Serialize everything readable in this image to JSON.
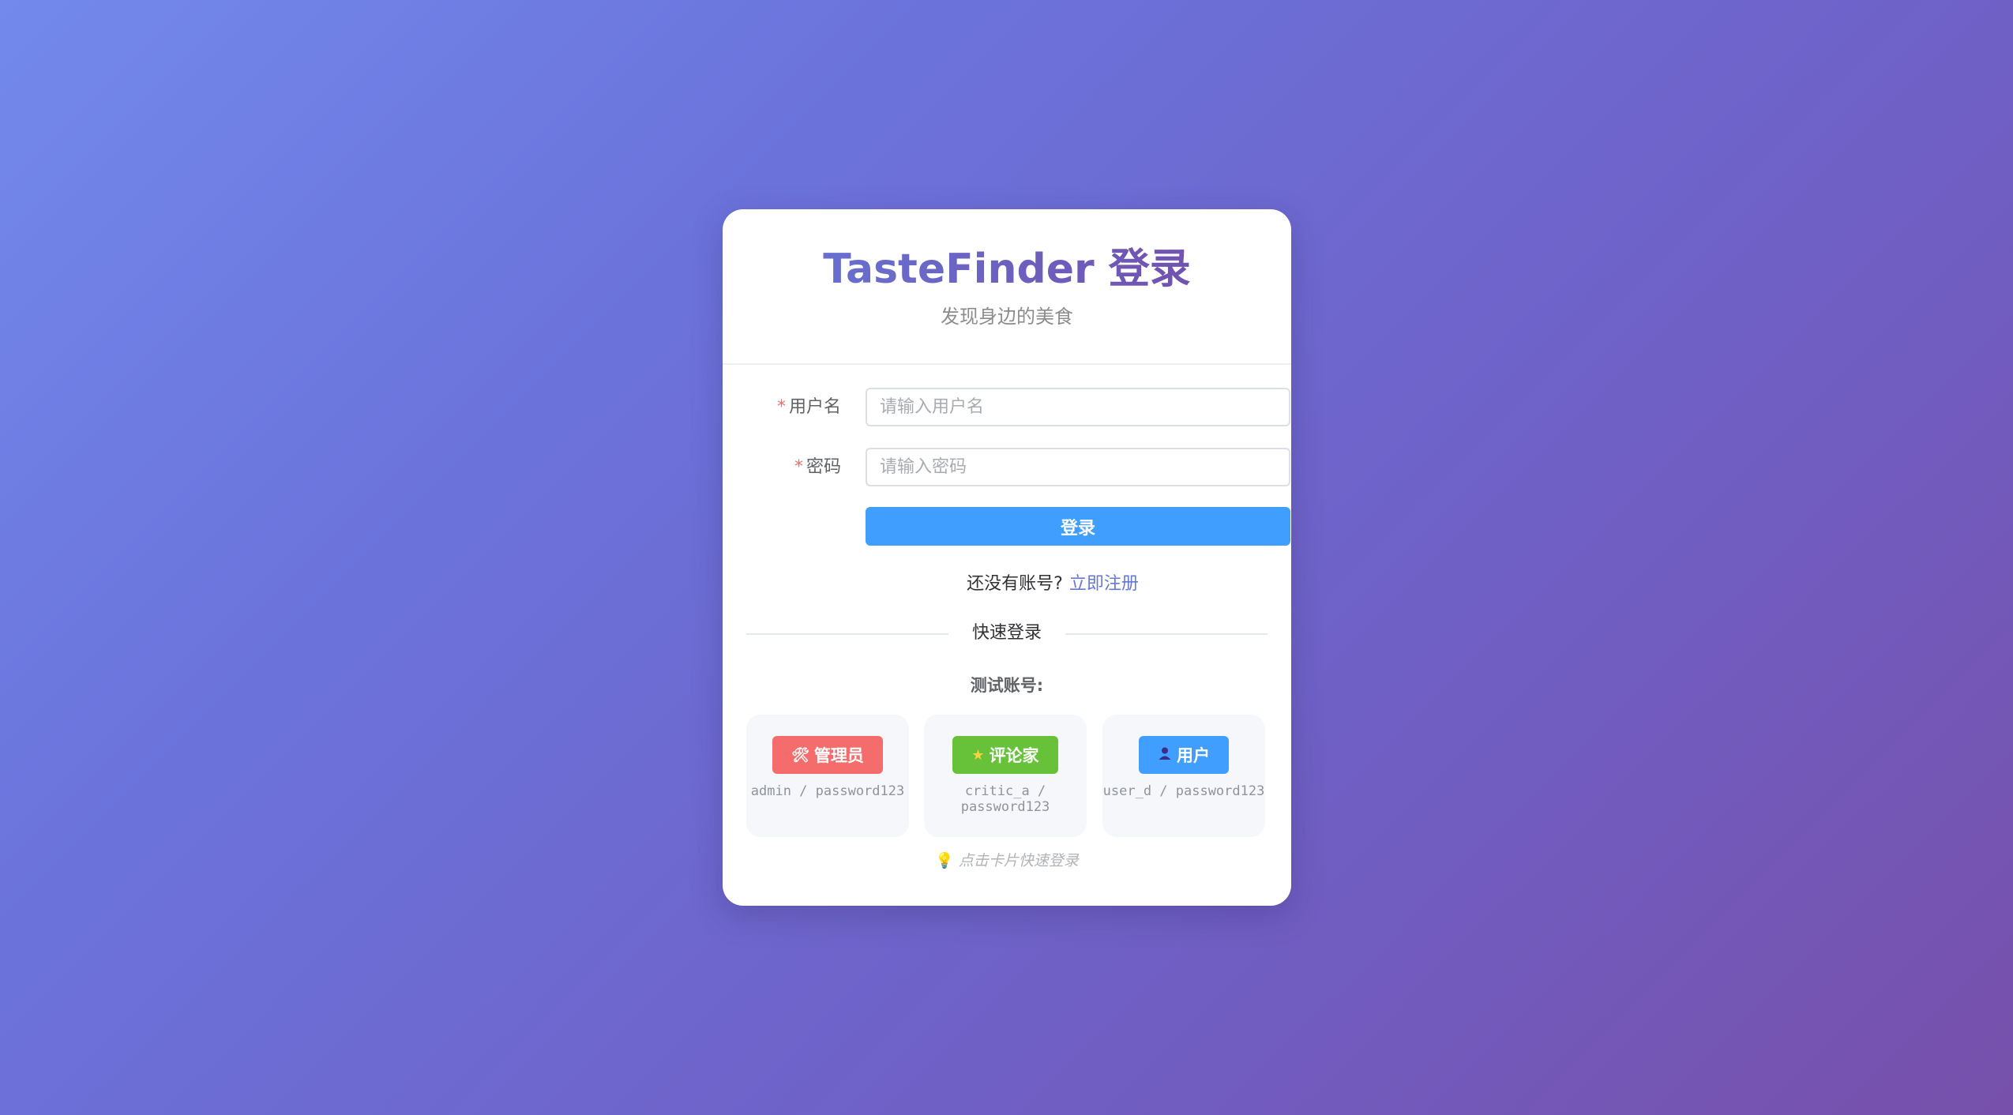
{
  "header": {
    "title": "TasteFinder 登录",
    "subtitle": "发现身边的美食"
  },
  "form": {
    "username": {
      "required_mark": "*",
      "label": "用户名",
      "placeholder": "请输入用户名",
      "value": ""
    },
    "password": {
      "required_mark": "*",
      "label": "密码",
      "placeholder": "请输入密码",
      "value": ""
    },
    "submit_label": "登录"
  },
  "register": {
    "prompt": "还没有账号?",
    "link": "立即注册"
  },
  "quick_login": {
    "divider_label": "快速登录",
    "test_title": "测试账号:",
    "accounts": [
      {
        "role": "管理员",
        "icon": "tools-icon",
        "credentials": "admin / password123",
        "color": "#f56c6c"
      },
      {
        "role": "评论家",
        "icon": "star-icon",
        "credentials": "critic_a / password123",
        "color": "#67c23a"
      },
      {
        "role": "用户",
        "icon": "user-icon",
        "credentials": "user_d / password123",
        "color": "#409eff"
      }
    ],
    "hint": "点击卡片快速登录"
  },
  "colors": {
    "accent": "#409eff",
    "title_gradient_start": "#6577d8",
    "title_gradient_end": "#744aa6",
    "required": "#f56c6c"
  }
}
